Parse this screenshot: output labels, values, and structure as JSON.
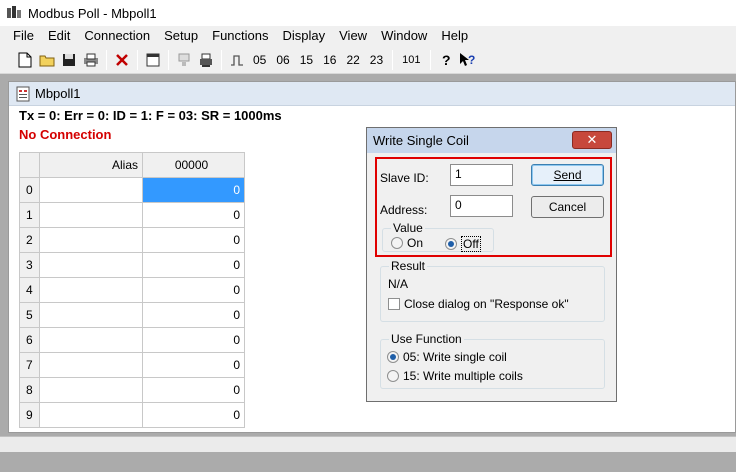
{
  "window": {
    "title": "Modbus Poll - Mbpoll1"
  },
  "menu": [
    "File",
    "Edit",
    "Connection",
    "Setup",
    "Functions",
    "Display",
    "View",
    "Window",
    "Help"
  ],
  "toolbar": {
    "func_codes": [
      "05",
      "06",
      "15",
      "16",
      "22",
      "23"
    ],
    "code_101": "101"
  },
  "child": {
    "title": "Mbpoll1",
    "status": "Tx = 0: Err = 0: ID = 1: F = 03: SR = 1000ms",
    "connection": "No Connection",
    "grid": {
      "alias_header": "Alias",
      "value_header": "00000",
      "rows": [
        {
          "index": "0",
          "value": "0"
        },
        {
          "index": "1",
          "value": "0"
        },
        {
          "index": "2",
          "value": "0"
        },
        {
          "index": "3",
          "value": "0"
        },
        {
          "index": "4",
          "value": "0"
        },
        {
          "index": "5",
          "value": "0"
        },
        {
          "index": "6",
          "value": "0"
        },
        {
          "index": "7",
          "value": "0"
        },
        {
          "index": "8",
          "value": "0"
        },
        {
          "index": "9",
          "value": "0"
        }
      ]
    }
  },
  "dialog": {
    "title": "Write Single Coil",
    "slave_id_label": "Slave ID:",
    "slave_id_value": "1",
    "address_label": "Address:",
    "address_value": "0",
    "send_label": "Send",
    "cancel_label": "Cancel",
    "value_group": "Value",
    "on_label": "On",
    "off_label": "Off",
    "result_group": "Result",
    "result_value": "N/A",
    "close_dialog_label": "Close dialog on \"Response ok\"",
    "use_function_group": "Use Function",
    "func05_label": "05: Write single coil",
    "func15_label": "15: Write multiple coils",
    "highlight_color": "#e00000"
  }
}
